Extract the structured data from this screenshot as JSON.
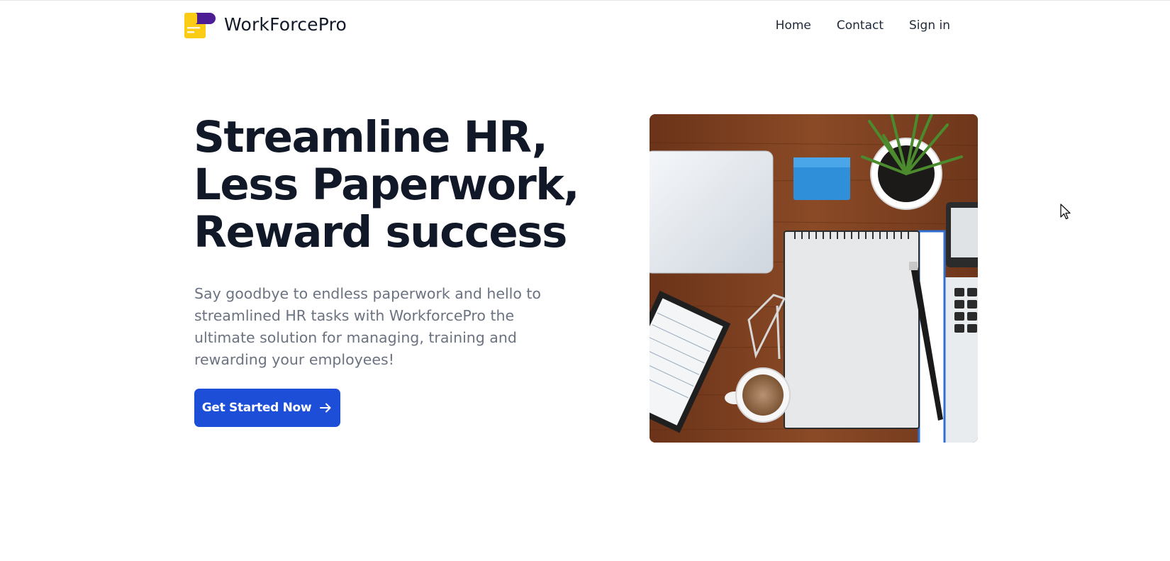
{
  "header": {
    "brand": "WorkForcePro",
    "logo_icon": "workforcepro-logo-icon",
    "nav": [
      {
        "label": "Home"
      },
      {
        "label": "Contact"
      },
      {
        "label": "Sign in"
      }
    ]
  },
  "hero": {
    "title_lines": [
      "Streamline HR,",
      "Less Paperwork,",
      "Reward success"
    ],
    "description": "Say goodbye to endless paperwork and hello to streamlined HR tasks with WorkforcePro the ultimate solution for managing, training and rewarding your employees!",
    "cta_label": "Get Started Now",
    "cta_icon": "arrow-right-icon",
    "image": "desk-workspace-photo"
  },
  "colors": {
    "accent": "#1d4ed8",
    "title": "#111827",
    "body_text": "#6b7280",
    "logo_yellow": "#facc15",
    "logo_purple": "#4c1d95"
  }
}
